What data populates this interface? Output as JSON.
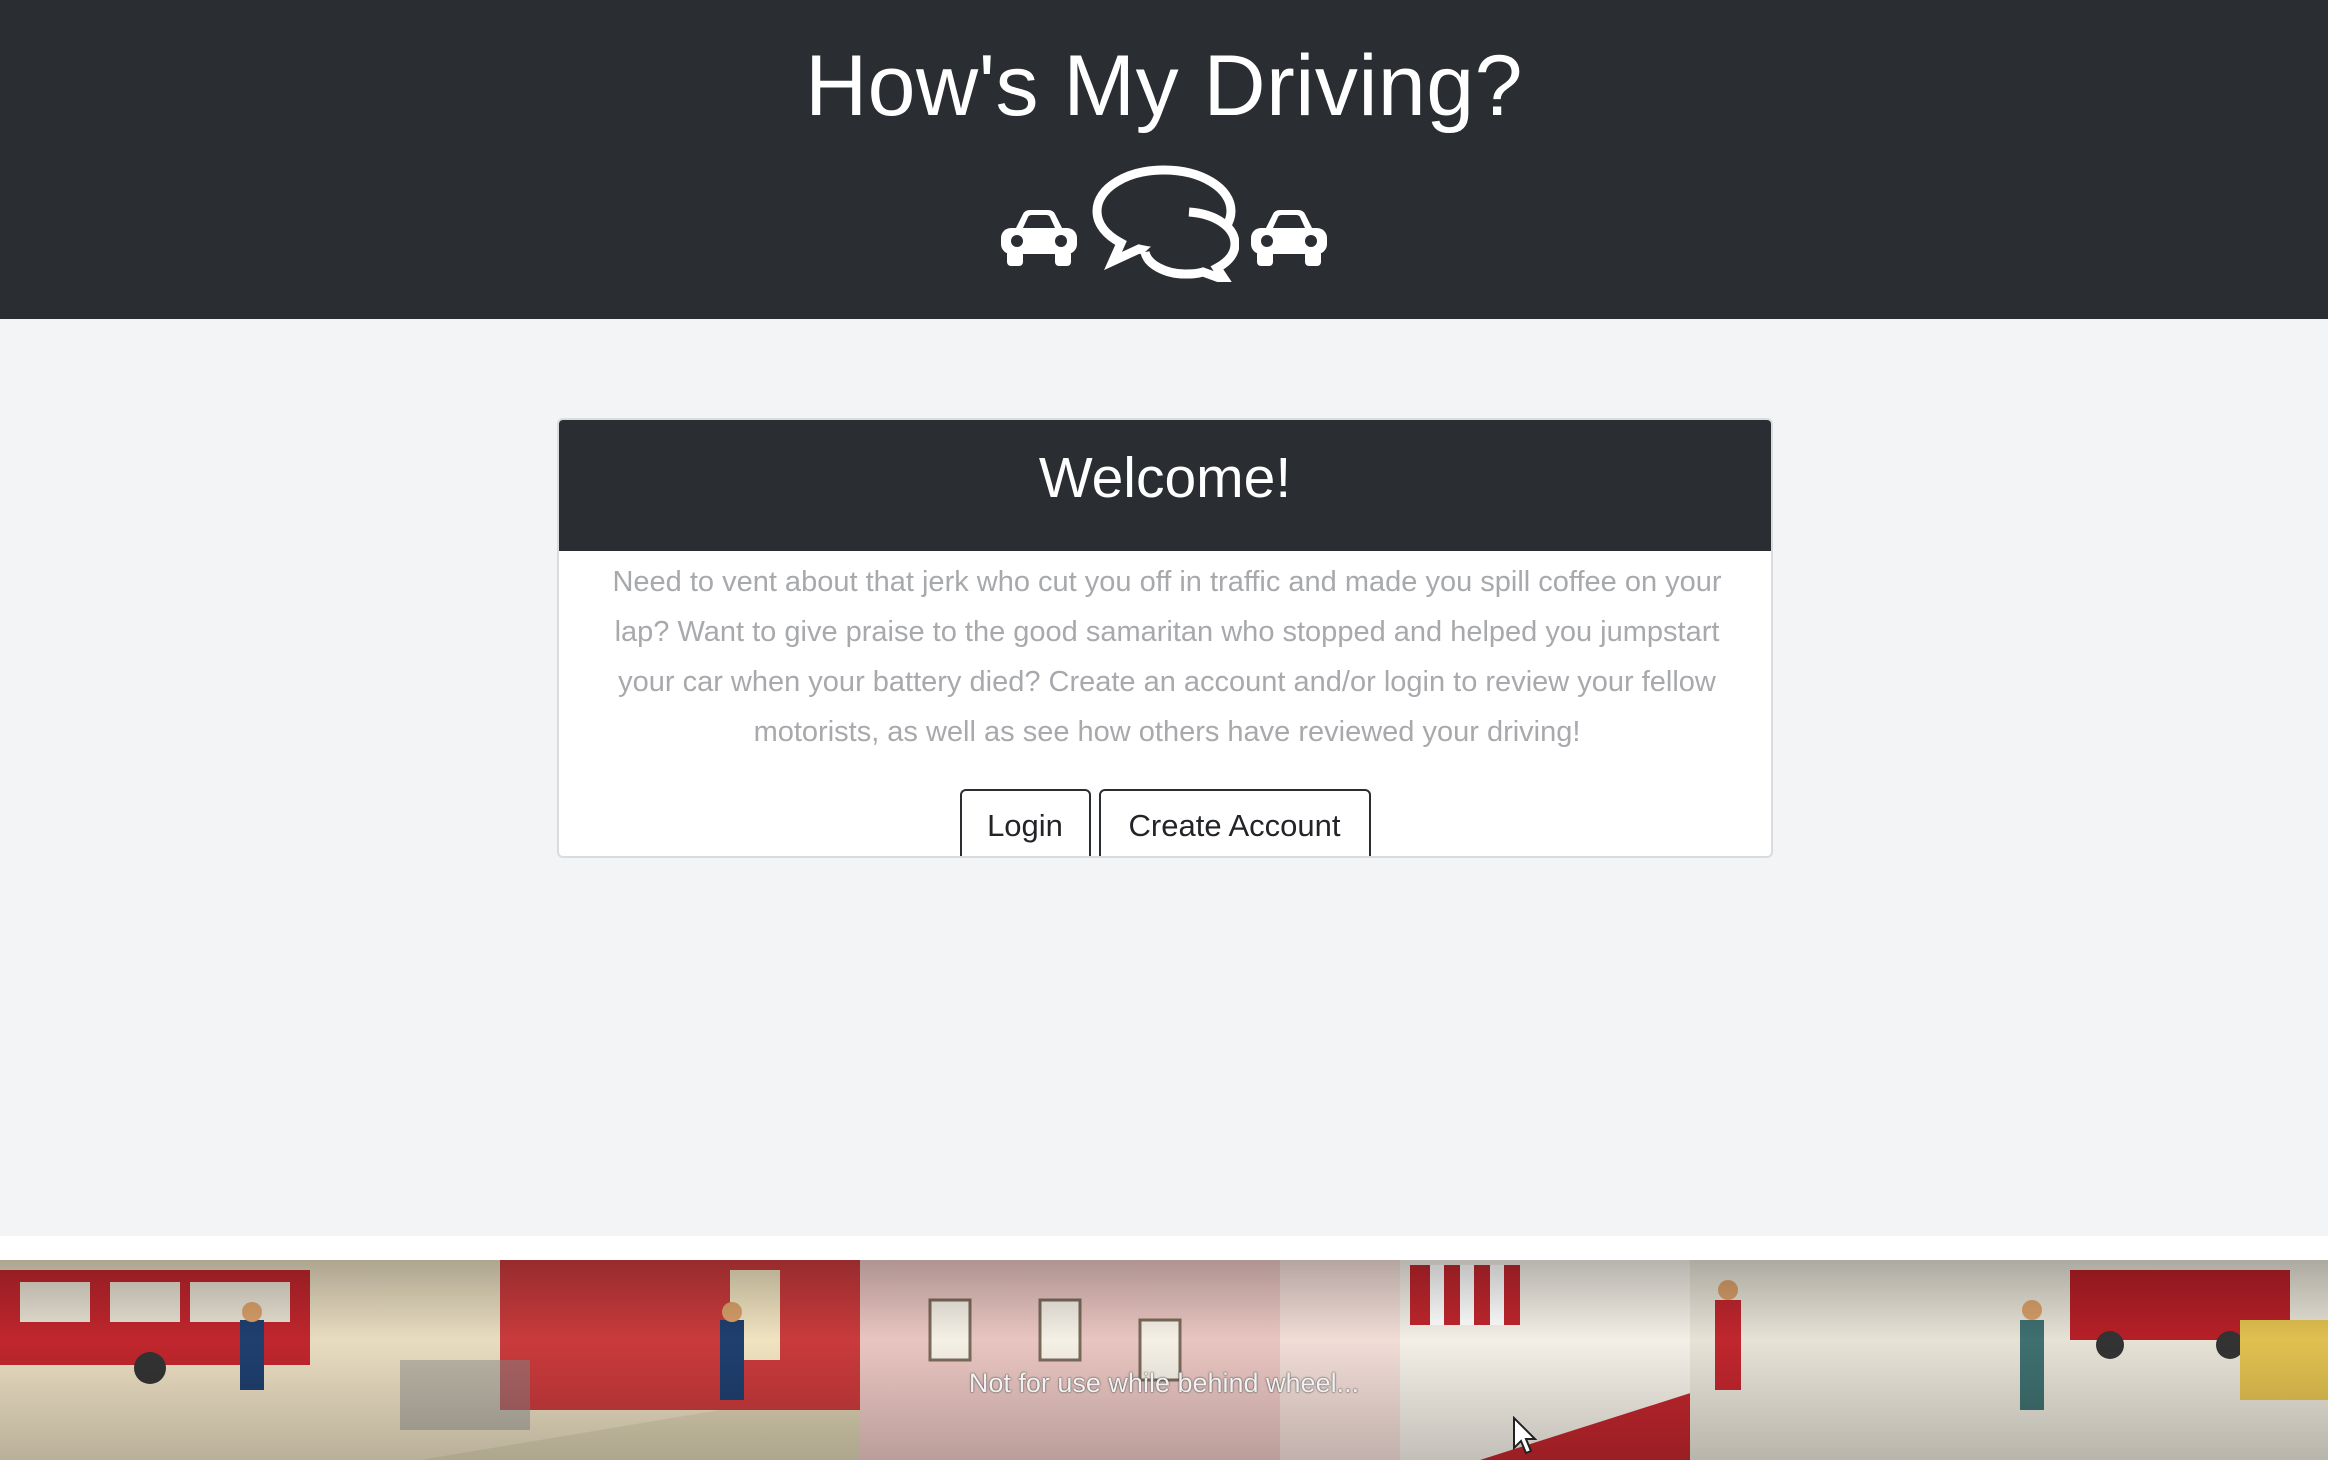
{
  "header": {
    "title": "How's My Driving?",
    "logo_icons": [
      "car-icon",
      "chat-bubbles-icon",
      "car-icon"
    ]
  },
  "welcome_card": {
    "title": "Welcome!",
    "text": "Need to vent about that jerk who cut you off in traffic and made you spill coffee on your lap? Want to give praise to the good samaritan who stopped and helped you jumpstart your car when your battery died? Create an account and/or login to review your fellow motorists, as well as see how others have reviewed your driving!",
    "login_label": "Login",
    "create_account_label": "Create Account"
  },
  "footer": {
    "caption": "Not for use while behind wheel...",
    "banner": "illustrated-street-scene-banner"
  },
  "colors": {
    "header_bg": "#2a2d31",
    "page_bg": "#f3f4f6",
    "card_text": "#a7a9ac",
    "banner_red": "#c0262d"
  }
}
